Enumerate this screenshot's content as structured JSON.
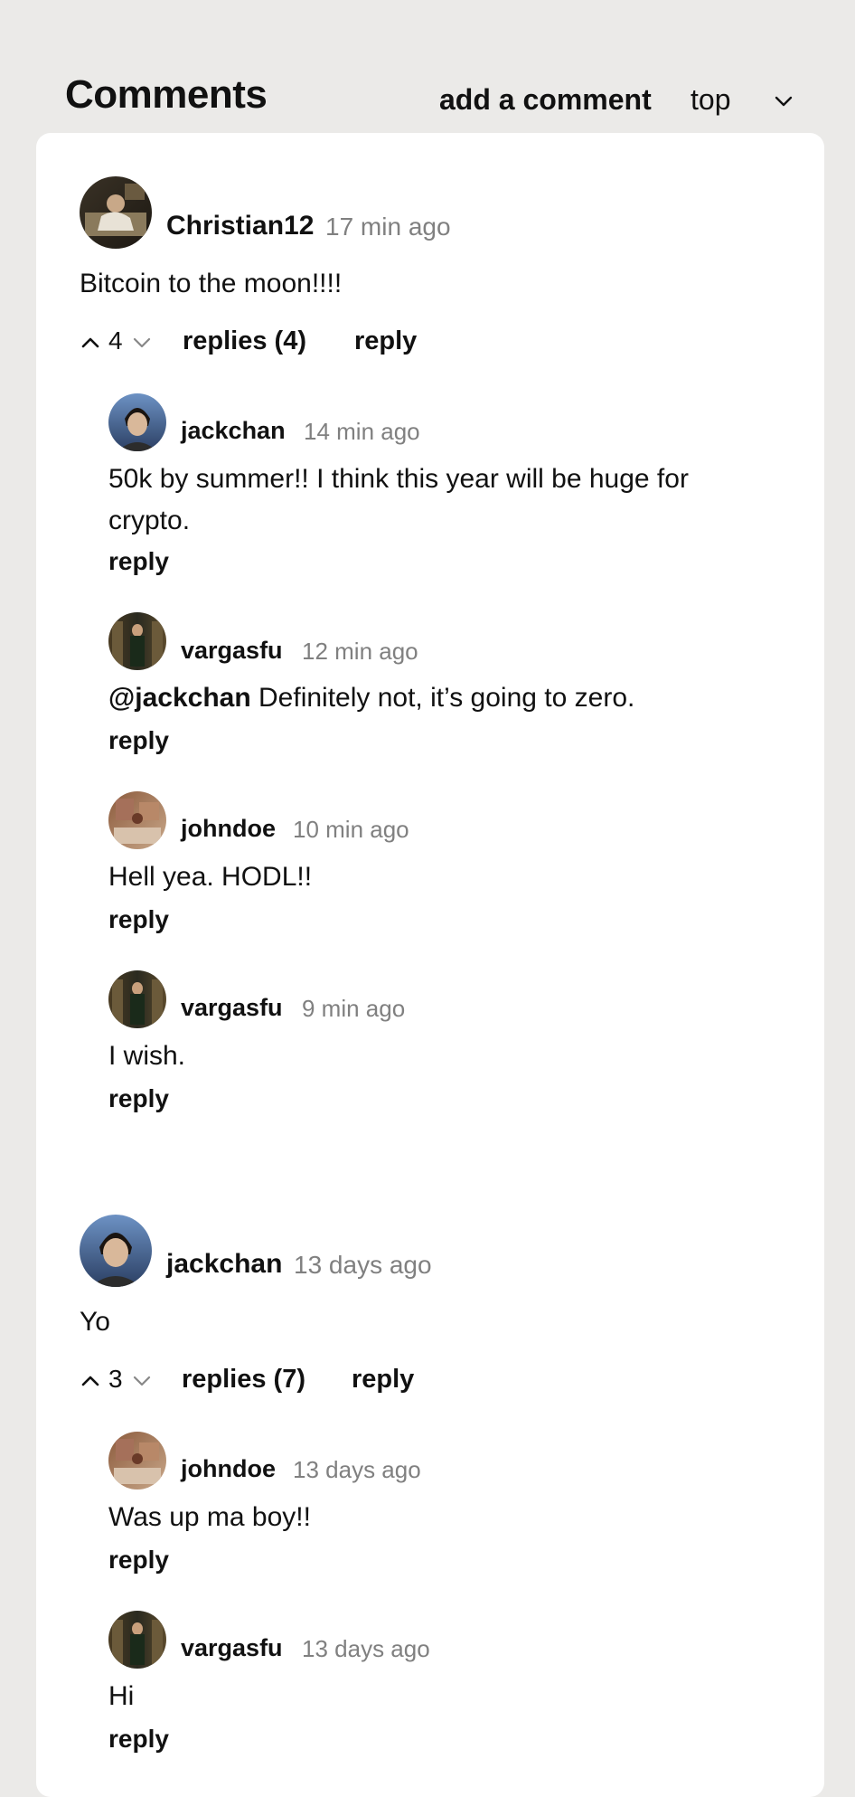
{
  "header": {
    "title": "Comments",
    "add_comment": "add a comment",
    "sort_value": "top"
  },
  "comments": [
    {
      "user": "Christian12",
      "time": "17 min ago",
      "text": "Bitcoin to the moon!!!!",
      "votes": "4",
      "replies_label": "replies (4)",
      "reply_label": "reply",
      "replies": [
        {
          "user": "jackchan",
          "time": "14 min ago",
          "text": "50k by summer!! I think this year will be huge for crypto.",
          "reply_label": "reply"
        },
        {
          "user": "vargasfu",
          "time": "12 min ago",
          "mention": "@jackchan",
          "text": " Definitely not, it’s going to zero.",
          "reply_label": "reply"
        },
        {
          "user": "johndoe",
          "time": "10 min ago",
          "text": "Hell yea. HODL!!",
          "reply_label": "reply"
        },
        {
          "user": "vargasfu",
          "time": "9 min ago",
          "text": "I wish.",
          "reply_label": "reply"
        }
      ]
    },
    {
      "user": "jackchan",
      "time": "13 days ago",
      "text": "Yo",
      "votes": "3",
      "replies_label": "replies (7)",
      "reply_label": "reply",
      "replies": [
        {
          "user": "johndoe",
          "time": "13 days ago",
          "text": "Was up ma boy!!",
          "reply_label": "reply"
        },
        {
          "user": "vargasfu",
          "time": "13 days ago",
          "text": "Hi",
          "reply_label": "reply"
        }
      ]
    }
  ],
  "icons": {
    "sort": "chevron-down-icon",
    "upvote": "chevron-up-icon",
    "downvote": "chevron-down-icon"
  }
}
